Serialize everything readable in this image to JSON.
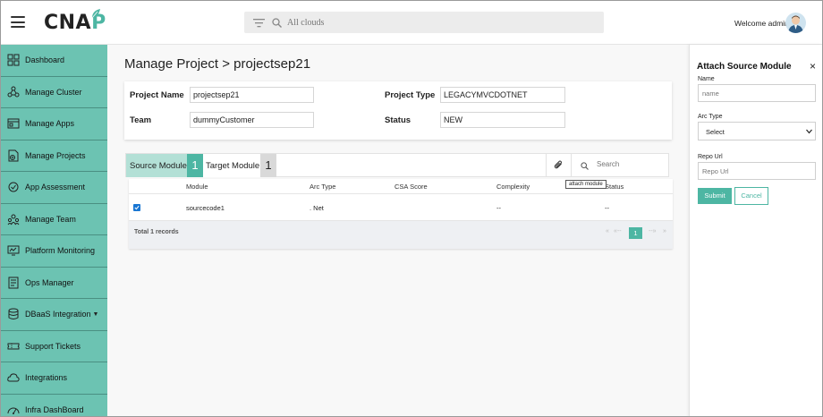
{
  "app": {
    "logo": "CNAP",
    "welcome": "Welcome admin"
  },
  "header": {
    "search_placeholder": "All clouds"
  },
  "sidebar": {
    "items": [
      {
        "label": "Dashboard",
        "icon": "dashboard-icon"
      },
      {
        "label": "Manage Cluster",
        "icon": "cluster-icon"
      },
      {
        "label": "Manage Apps",
        "icon": "apps-icon"
      },
      {
        "label": "Manage Projects",
        "icon": "projects-icon"
      },
      {
        "label": "App Assessment",
        "icon": "assessment-icon"
      },
      {
        "label": "Manage Team",
        "icon": "team-icon"
      },
      {
        "label": "Platform Monitoring",
        "icon": "monitoring-icon"
      },
      {
        "label": "Ops Manager",
        "icon": "ops-icon"
      },
      {
        "label": "DBaaS Integration",
        "icon": "database-icon"
      },
      {
        "label": "Support Tickets",
        "icon": "ticket-icon"
      },
      {
        "label": "Integrations",
        "icon": "cloud-icon"
      },
      {
        "label": "Infra DashBoard",
        "icon": "infra-icon"
      }
    ]
  },
  "main": {
    "title": "Manage Project > projectsep21",
    "info": {
      "project_name_label": "Project Name",
      "project_name": "projectsep21",
      "project_type_label": "Project Type",
      "project_type": "LEGACYMVCDOTNET",
      "team_label": "Team",
      "team": "dummyCustomer",
      "status_label": "Status",
      "status": "NEW"
    },
    "tabs": {
      "source_label": "Source Module",
      "source_count": "1",
      "target_label": "Target Module",
      "target_count": "1"
    },
    "search_placeholder": "Search",
    "tooltip": "attach module",
    "table": {
      "columns": [
        "Module",
        "Arc Type",
        "CSA Score",
        "Complexity",
        "Status"
      ],
      "rows": [
        {
          "module": "sourcecode1",
          "arc_type": ". Net",
          "csa_score": "",
          "complexity": "--",
          "status": "--"
        }
      ],
      "total": "Total 1 records",
      "pager_first": "«",
      "pager_prev": "«--",
      "pager_next": "--»",
      "pager_last": "»",
      "page": "1"
    }
  },
  "panel": {
    "title": "Attach Source Module",
    "close": "×",
    "name_label": "Name",
    "name_placeholder": "name",
    "arc_label": "Arc Type",
    "arc_value": "Select",
    "repo_label": "Repo Url",
    "repo_placeholder": "Repo Url",
    "submit": "Submit",
    "cancel": "Cancel"
  },
  "colors": {
    "accent": "#4db6a3",
    "sidebar": "#6cc3b2",
    "tab_active": "#b3e0d6"
  }
}
